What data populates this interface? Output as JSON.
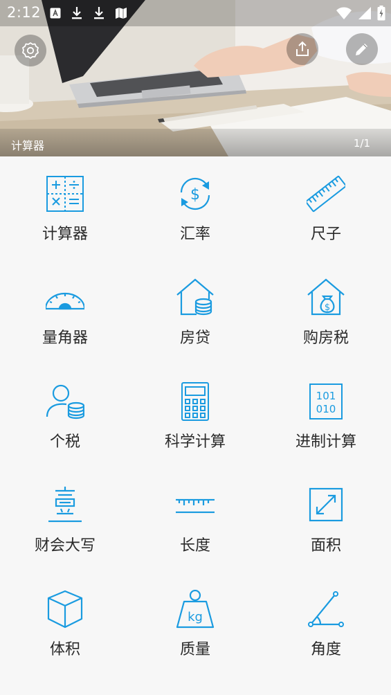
{
  "status_bar": {
    "time": "2:12",
    "left_icons": [
      "text-a-icon",
      "download-icon",
      "download-icon",
      "map-icon"
    ],
    "right_icons": [
      "wifi-icon",
      "signal-icon",
      "battery-charging-icon"
    ]
  },
  "banner": {
    "title": "计算器",
    "page_indicator": "1/1",
    "buttons": [
      "settings-icon",
      "share-icon",
      "edit-icon"
    ]
  },
  "accent_color": "#1a9be0",
  "tools": [
    {
      "label": "计算器",
      "icon": "calculator-icon"
    },
    {
      "label": "汇率",
      "icon": "exchange-rate-icon"
    },
    {
      "label": "尺子",
      "icon": "ruler-icon"
    },
    {
      "label": "量角器",
      "icon": "protractor-icon"
    },
    {
      "label": "房贷",
      "icon": "mortgage-icon"
    },
    {
      "label": "购房税",
      "icon": "house-tax-icon"
    },
    {
      "label": "个税",
      "icon": "income-tax-icon"
    },
    {
      "label": "科学计算",
      "icon": "scientific-calculator-icon"
    },
    {
      "label": "进制计算",
      "icon": "binary-icon"
    },
    {
      "label": "财会大写",
      "icon": "chinese-numeral-icon"
    },
    {
      "label": "长度",
      "icon": "length-icon"
    },
    {
      "label": "面积",
      "icon": "area-icon"
    },
    {
      "label": "体积",
      "icon": "volume-icon"
    },
    {
      "label": "质量",
      "icon": "weight-icon"
    },
    {
      "label": "角度",
      "icon": "angle-icon"
    }
  ]
}
